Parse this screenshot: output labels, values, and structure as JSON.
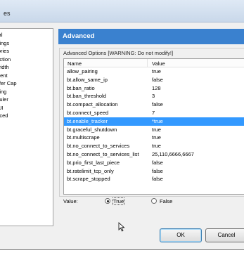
{
  "window": {
    "title": "es"
  },
  "tree": {
    "items": [
      "eral",
      "ettings",
      "ctories",
      "nection",
      "dwidth",
      "orrent",
      "nsfer Cap",
      "ueing",
      "eduler",
      "o UI",
      "anced"
    ]
  },
  "panel": {
    "header": "Advanced",
    "group_label": "Advanced Options [WARNING: Do not modify!]",
    "columns": {
      "name": "Name",
      "value": "Value"
    },
    "rows": [
      {
        "name": "allow_pairing",
        "value": "true"
      },
      {
        "name": "bt.allow_same_ip",
        "value": "false"
      },
      {
        "name": "bt.ban_ratio",
        "value": "128"
      },
      {
        "name": "bt.ban_threshold",
        "value": "3"
      },
      {
        "name": "bt.compact_allocation",
        "value": "false"
      },
      {
        "name": "bt.connect_speed",
        "value": "7"
      },
      {
        "name": "bt.enable_tracker",
        "value": "*true"
      },
      {
        "name": "bt.graceful_shutdown",
        "value": "true"
      },
      {
        "name": "bt.multiscrape",
        "value": "true"
      },
      {
        "name": "bt.no_connect_to_services",
        "value": "true"
      },
      {
        "name": "bt.no_connect_to_services_list",
        "value": "25,110,6666,6667"
      },
      {
        "name": "bt.prio_first_last_piece",
        "value": "false"
      },
      {
        "name": "bt.ratelimit_tcp_only",
        "value": "false"
      },
      {
        "name": "bt.scrape_stopped",
        "value": "false"
      }
    ],
    "selected_row_index": 6
  },
  "value_editor": {
    "label": "Value:",
    "option_true": "True",
    "option_false": "False",
    "selected": "True"
  },
  "buttons": {
    "ok": "OK",
    "cancel": "Cancel"
  },
  "colors": {
    "header_bg": "#3a81cf",
    "selection_bg": "#3399ff"
  }
}
